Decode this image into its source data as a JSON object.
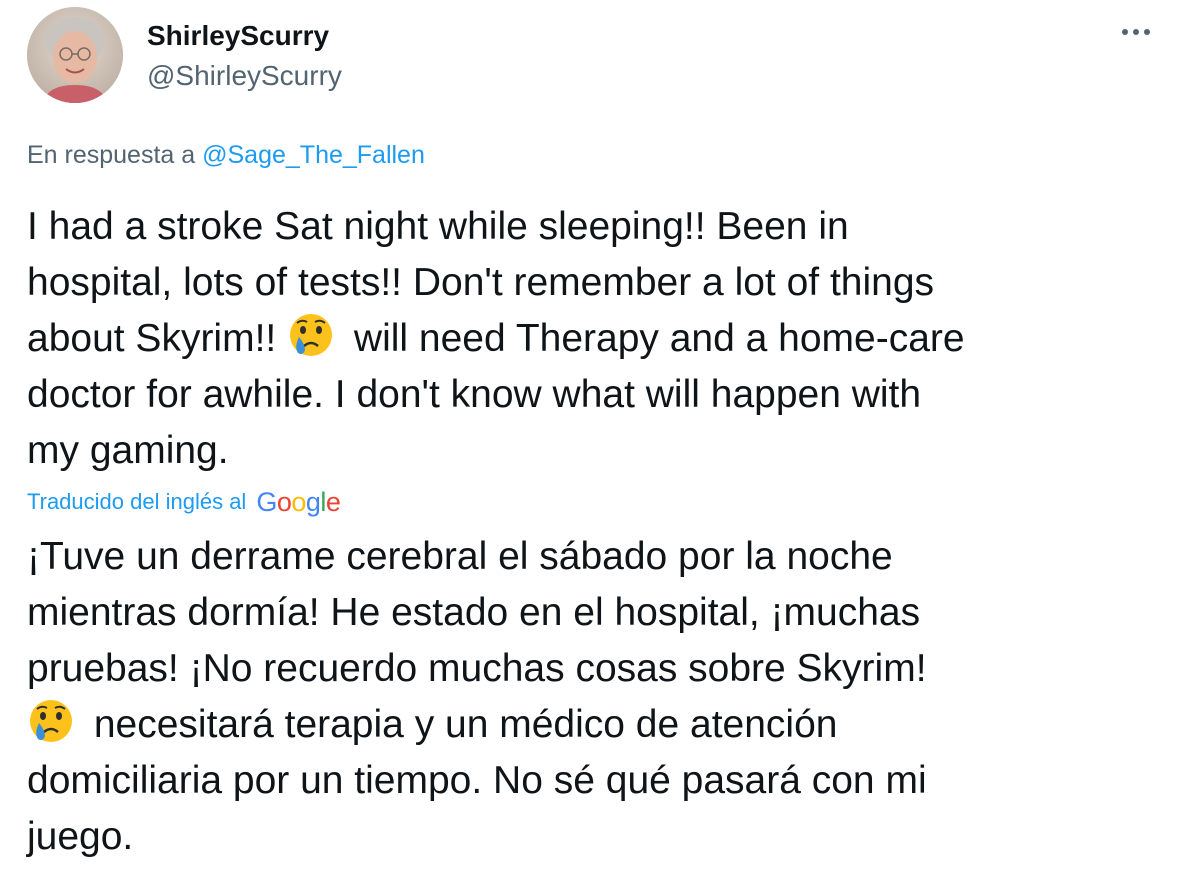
{
  "user": {
    "display_name": "ShirleyScurry",
    "handle": "@ShirleyScurry",
    "avatar_icon": "user-avatar"
  },
  "menu": {
    "more_icon": "more-dots-icon"
  },
  "reply": {
    "prefix": "En respuesta a ",
    "mention": "@Sage_The_Fallen"
  },
  "original_text": {
    "lines": [
      {
        "pre": "I had a stroke Sat night while sleeping!!  Been in"
      },
      {
        "pre": "hospital, lots of tests!!  Don't remember a lot of things"
      },
      {
        "pre": "about Skyrim!! ",
        "emoji": "crying-face-emoji",
        "post": "  will need Therapy and a home-care"
      },
      {
        "pre": "doctor for awhile.  I don't know what will happen with"
      },
      {
        "pre": "my gaming."
      }
    ]
  },
  "translation": {
    "label": "Traducido del inglés al",
    "provider": "Google",
    "lines": [
      {
        "pre": "¡Tuve un derrame cerebral el sábado por la noche"
      },
      {
        "pre": "mientras dormía! He estado en el hospital, ¡muchas"
      },
      {
        "pre": "pruebas! ¡No recuerdo muchas cosas sobre Skyrim!"
      },
      {
        "pre": "",
        "emoji": "crying-face-emoji",
        "post": " necesitará terapia y un médico de atención"
      },
      {
        "pre": "domiciliaria por un tiempo. No sé qué pasará con mi"
      },
      {
        "pre": "juego."
      }
    ]
  },
  "colors": {
    "text_primary": "#0f1419",
    "text_secondary": "#536471",
    "link": "#1d9bf0"
  }
}
